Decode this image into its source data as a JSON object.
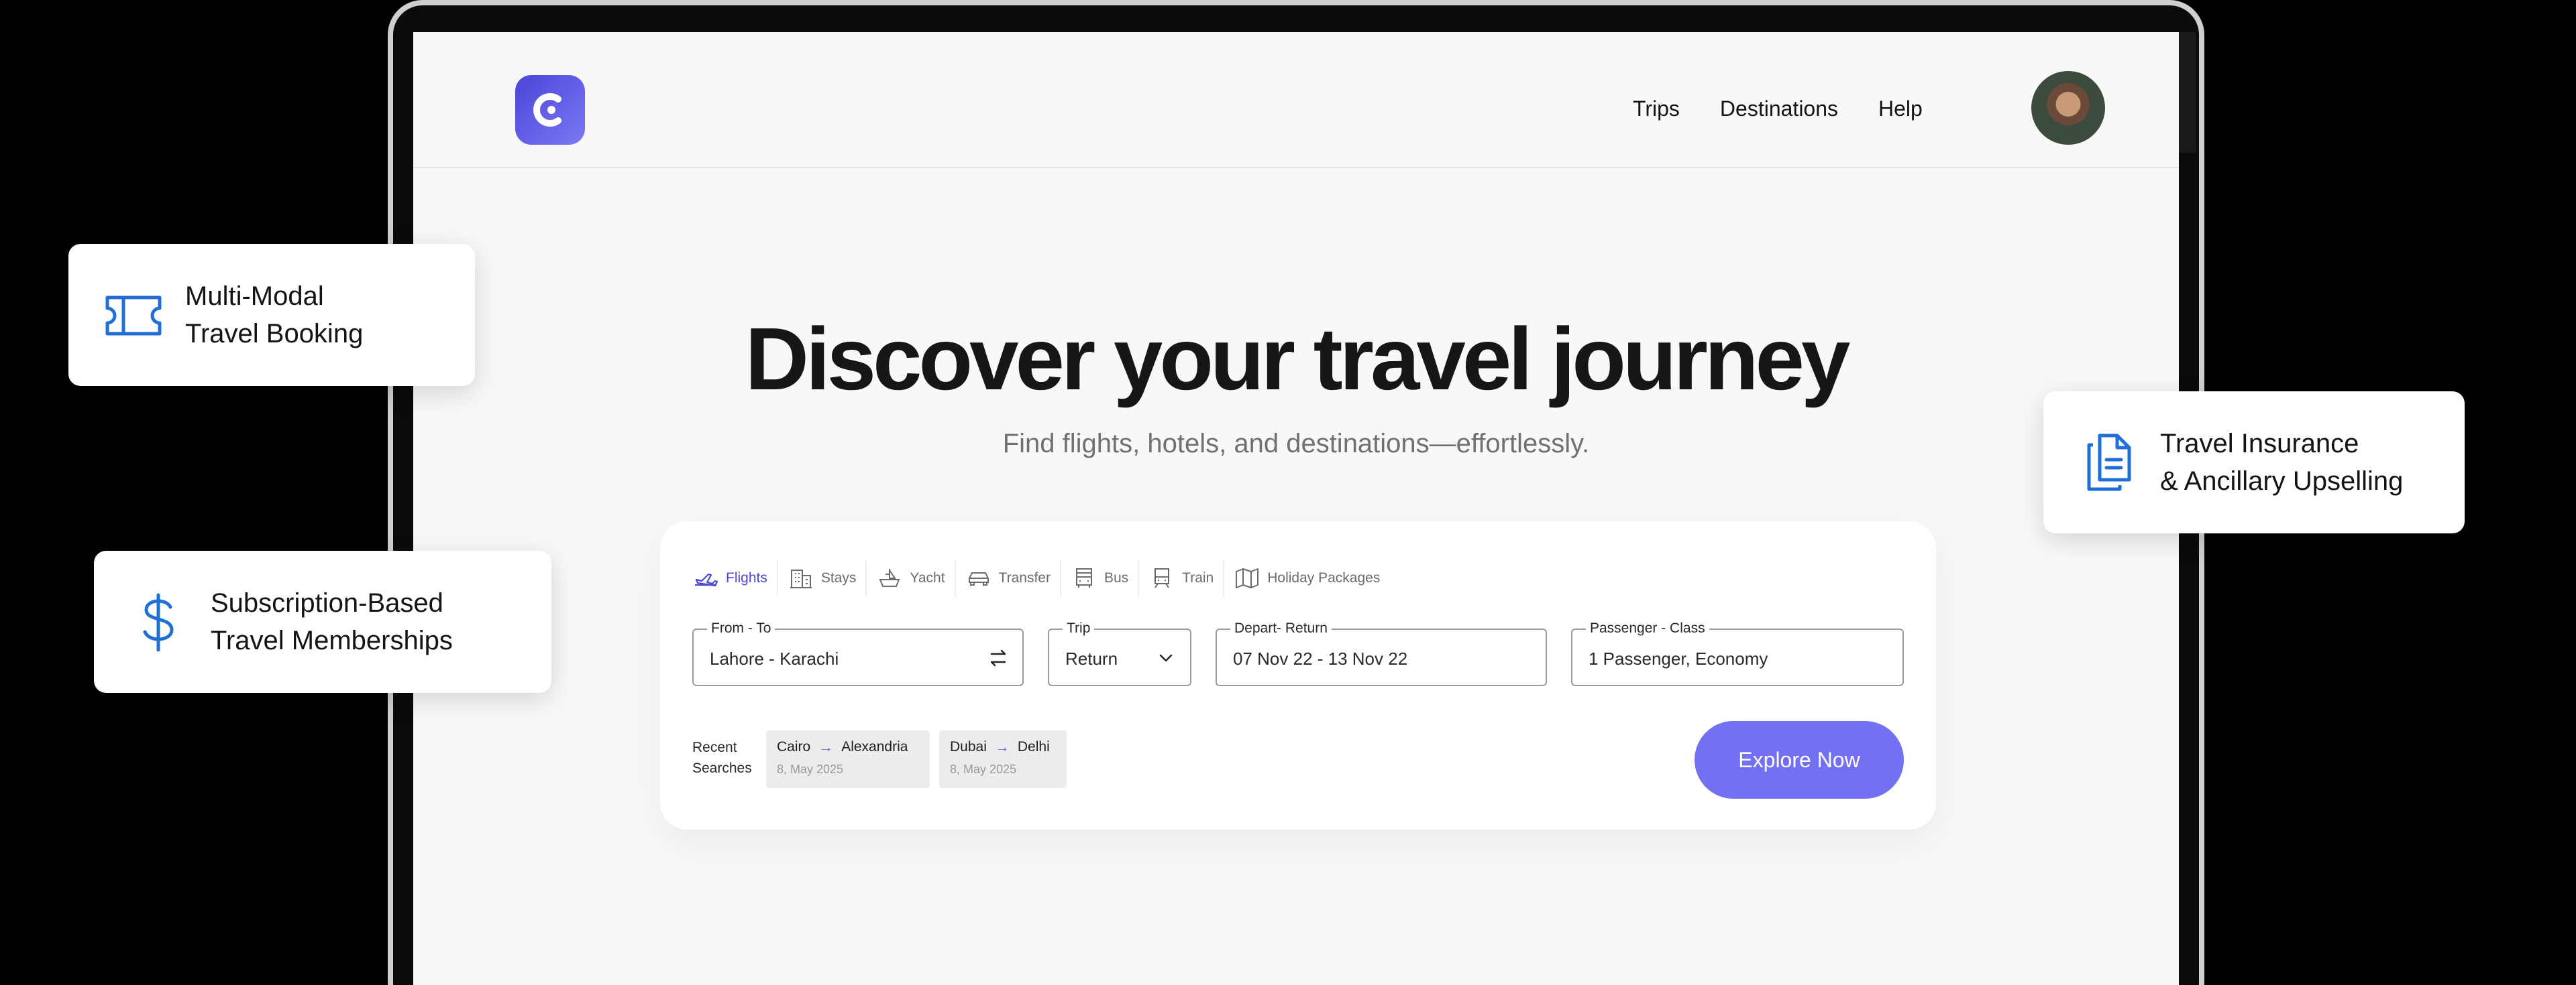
{
  "header": {
    "nav": [
      "Trips",
      "Destinations",
      "Help"
    ]
  },
  "hero": {
    "title": "Discover your travel journey",
    "subtitle": "Find flights, hotels, and destinations—effortlessly."
  },
  "search": {
    "tabs": [
      {
        "label": "Flights",
        "icon": "plane-icon",
        "active": true
      },
      {
        "label": "Stays",
        "icon": "building-icon",
        "active": false
      },
      {
        "label": "Yacht",
        "icon": "yacht-icon",
        "active": false
      },
      {
        "label": "Transfer",
        "icon": "car-icon",
        "active": false
      },
      {
        "label": "Bus",
        "icon": "bus-icon",
        "active": false
      },
      {
        "label": "Train",
        "icon": "train-icon",
        "active": false
      },
      {
        "label": "Holiday Packages",
        "icon": "map-icon",
        "active": false
      }
    ],
    "fields": {
      "from_to": {
        "label": "From - To",
        "value": "Lahore - Karachi"
      },
      "trip": {
        "label": "Trip",
        "value": "Return"
      },
      "dates": {
        "label": "Depart- Return",
        "value": "07 Nov 22 - 13 Nov 22"
      },
      "passenger": {
        "label": "Passenger - Class",
        "value": "1 Passenger, Economy"
      }
    },
    "recent": {
      "label_line1": "Recent",
      "label_line2": "Searches",
      "items": [
        {
          "from": "Cairo",
          "to": "Alexandria",
          "date": "8, May 2025"
        },
        {
          "from": "Dubai",
          "to": "Delhi",
          "date": "8, May 2025"
        }
      ]
    },
    "cta": "Explore Now"
  },
  "features": {
    "booking": {
      "line1": "Multi-Modal",
      "line2": "Travel Booking",
      "icon": "ticket-icon"
    },
    "subscription": {
      "line1": "Subscription-Based",
      "line2": "Travel Memberships",
      "icon": "dollar-icon"
    },
    "insurance": {
      "line1": "Travel Insurance",
      "line2": "& Ancillary Upselling",
      "icon": "documents-icon"
    }
  },
  "colors": {
    "accent": "#7470f2",
    "active_tab": "#4b46d6",
    "feature_icon": "#1f6fd6",
    "background": "#000000"
  }
}
